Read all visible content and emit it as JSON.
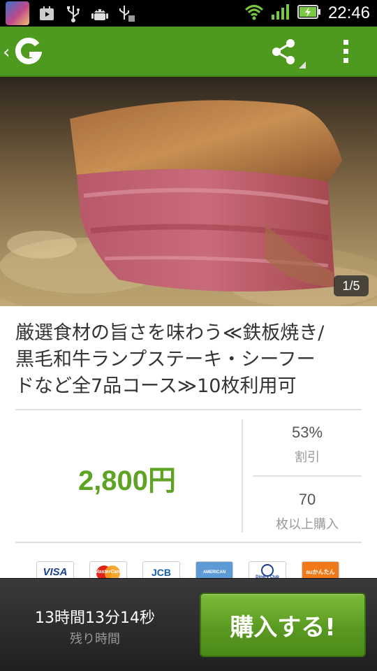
{
  "status_bar": {
    "time": "22:46",
    "left_icons": [
      "app-icon",
      "play-store-icon",
      "usb-icon",
      "android-debug-icon",
      "usb-icon"
    ],
    "right_icons": [
      "wifi-icon",
      "signal-icon",
      "battery-charging-icon"
    ]
  },
  "action_bar": {
    "logo_icon": "gurunavi-g-logo",
    "share_icon": "share-icon",
    "overflow_icon": "overflow-menu-icon",
    "color": "#4e9a1e"
  },
  "hero": {
    "counter": "1/5"
  },
  "deal": {
    "title_lines": [
      "厳選食材の旨さを味わう≪鉄板焼き/",
      "黒毛和牛ランプステーキ・シーフー",
      "ドなど全7品コース≫10枚利用可"
    ],
    "price": "2,800円",
    "discount_value": "53%",
    "discount_label": "割引",
    "min_value": "70",
    "min_label": "枚以上購入",
    "price_color": "#5fa324"
  },
  "payment_cards": [
    "VISA",
    "MasterCard",
    "JCB",
    "AMERICAN EXPRESS",
    "Diners Club",
    "auかんたん"
  ],
  "bottom": {
    "timer": "13時間13分14秒",
    "timer_label": "残り時間",
    "buy_label": "購入する!"
  }
}
